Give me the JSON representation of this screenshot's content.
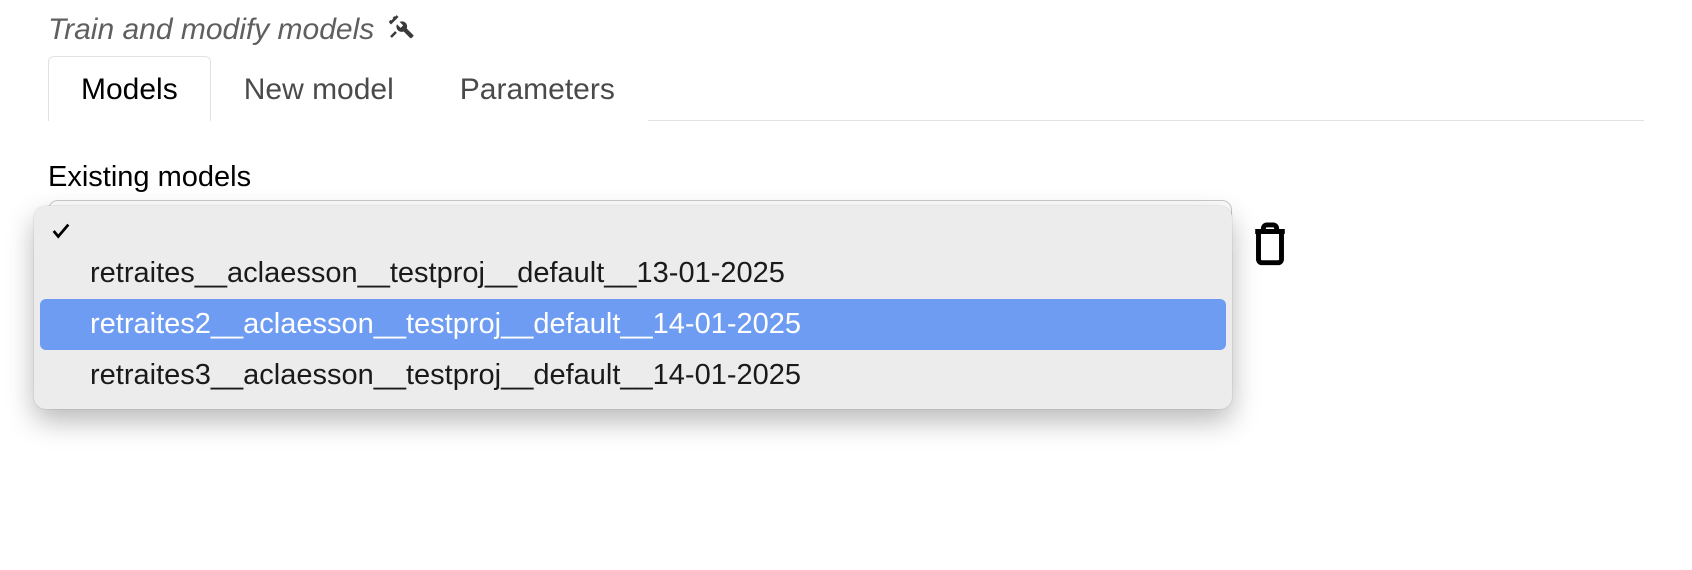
{
  "header": {
    "title": "Train and modify models"
  },
  "tabs": [
    {
      "label": "Models",
      "active": true
    },
    {
      "label": "New model",
      "active": false
    },
    {
      "label": "Parameters",
      "active": false
    }
  ],
  "section": {
    "label": "Existing models"
  },
  "dropdown": {
    "options": [
      {
        "label": "",
        "selected": true,
        "highlighted": false
      },
      {
        "label": "retraites__aclaesson__testproj__default__13-01-2025",
        "selected": false,
        "highlighted": false
      },
      {
        "label": "retraites2__aclaesson__testproj__default__14-01-2025",
        "selected": false,
        "highlighted": true
      },
      {
        "label": "retraites3__aclaesson__testproj__default__14-01-2025",
        "selected": false,
        "highlighted": false
      }
    ]
  },
  "colors": {
    "highlight": "#6d9cf2",
    "border": "#e2e2e2",
    "dropdownBg": "#ececec"
  }
}
